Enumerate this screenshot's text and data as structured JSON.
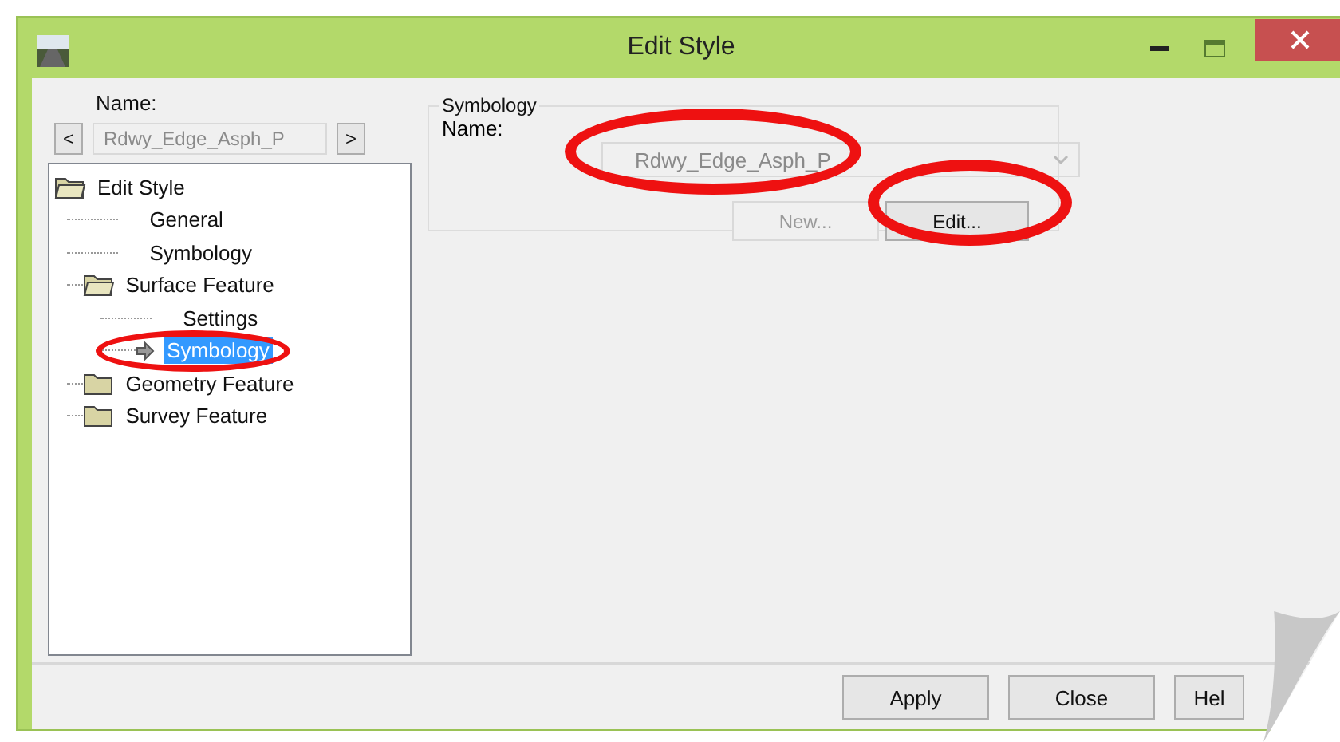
{
  "window": {
    "title": "Edit Style"
  },
  "name_panel": {
    "label": "Name:",
    "value": "Rdwy_Edge_Asph_P",
    "prev": "<",
    "next": ">"
  },
  "tree": [
    {
      "label": "Edit Style",
      "expanded": true,
      "selected": false,
      "children": [
        {
          "label": "General",
          "selected": false
        },
        {
          "label": "Symbology",
          "selected": false
        },
        {
          "label": "Surface Feature",
          "expanded": true,
          "selected": false,
          "children": [
            {
              "label": "Settings",
              "selected": false
            },
            {
              "label": "Symbology",
              "selected": true
            }
          ]
        },
        {
          "label": "Geometry Feature",
          "expanded": false,
          "selected": false
        },
        {
          "label": "Survey Feature",
          "expanded": false,
          "selected": false
        }
      ]
    }
  ],
  "symbology": {
    "title": "Symbology",
    "name_label": "Name:",
    "value": "Rdwy_Edge_Asph_P",
    "buttons": [
      {
        "label": "New...",
        "disabled": true
      },
      {
        "label": "Edit...",
        "disabled": false
      }
    ]
  },
  "buttons": [
    "Apply",
    "Close",
    "Hel"
  ]
}
